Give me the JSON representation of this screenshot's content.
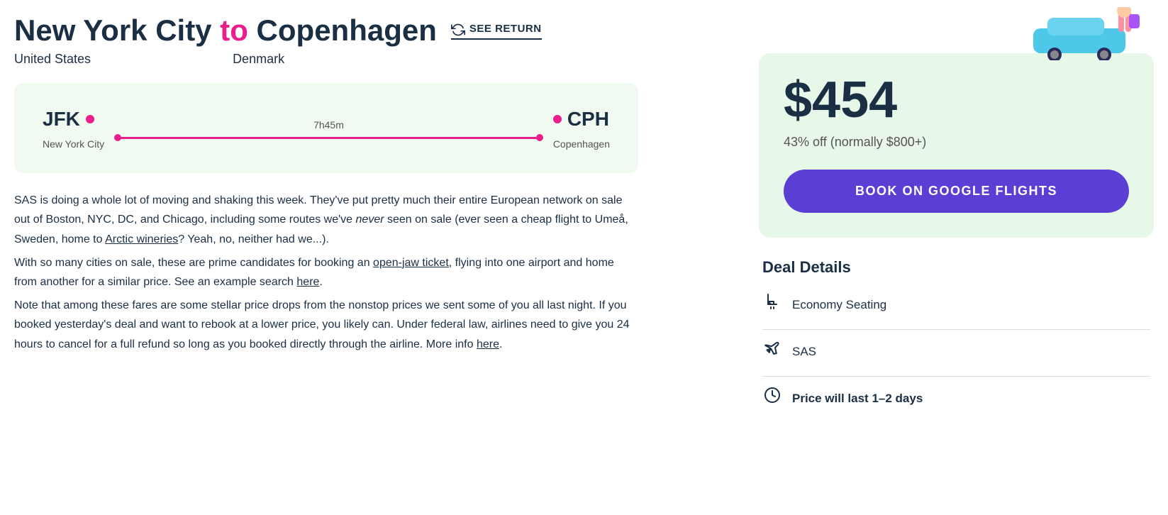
{
  "header": {
    "origin_city": "New York City",
    "to_word": "to",
    "destination_city": "Copenhagen",
    "origin_country": "United States",
    "destination_country": "Denmark",
    "see_return_label": "SEE RETURN"
  },
  "flight": {
    "origin_code": "JFK",
    "origin_city": "New York City",
    "destination_code": "CPH",
    "destination_city": "Copenhagen",
    "duration": "7h45m"
  },
  "description": {
    "paragraph1": "SAS is doing a whole lot of moving and shaking this week. They've put pretty much their entire European network on sale out of Boston, NYC, DC, and Chicago, including some routes we've ",
    "italic_word": "never",
    "paragraph1b": " seen on sale (ever seen a cheap flight to Umeå, Sweden, home to ",
    "link1_text": "Arctic wineries",
    "paragraph1c": "? Yeah, no, neither had we...).",
    "paragraph2_start": "With so many cities on sale, these are prime candidates for booking an ",
    "link2_text": "open-jaw ticket",
    "paragraph2b": ", flying into one airport and home from another for a similar price. See an example search ",
    "link3_text": "here",
    "paragraph2c": ".",
    "paragraph3": "Note that among these fares are some stellar price drops from the nonstop prices we sent some of you all last night. If you booked yesterday's deal and want to rebook at a lower price, you likely can. Under federal law, airlines need to give you 24 hours to cancel for a full refund so long as you booked directly through the airline. More info ",
    "link4_text": "here",
    "paragraph3c": "."
  },
  "sidebar": {
    "price": "$454",
    "discount": "43% off (normally $800+)",
    "book_button_label": "BOOK ON GOOGLE FLIGHTS",
    "deal_details_title": "Deal Details",
    "details": [
      {
        "icon": "seat-icon",
        "text": "Economy Seating",
        "bold": false
      },
      {
        "icon": "plane-icon",
        "text": "SAS",
        "bold": false
      },
      {
        "icon": "clock-icon",
        "text": "Price will last 1–2 days",
        "bold": true
      }
    ]
  }
}
